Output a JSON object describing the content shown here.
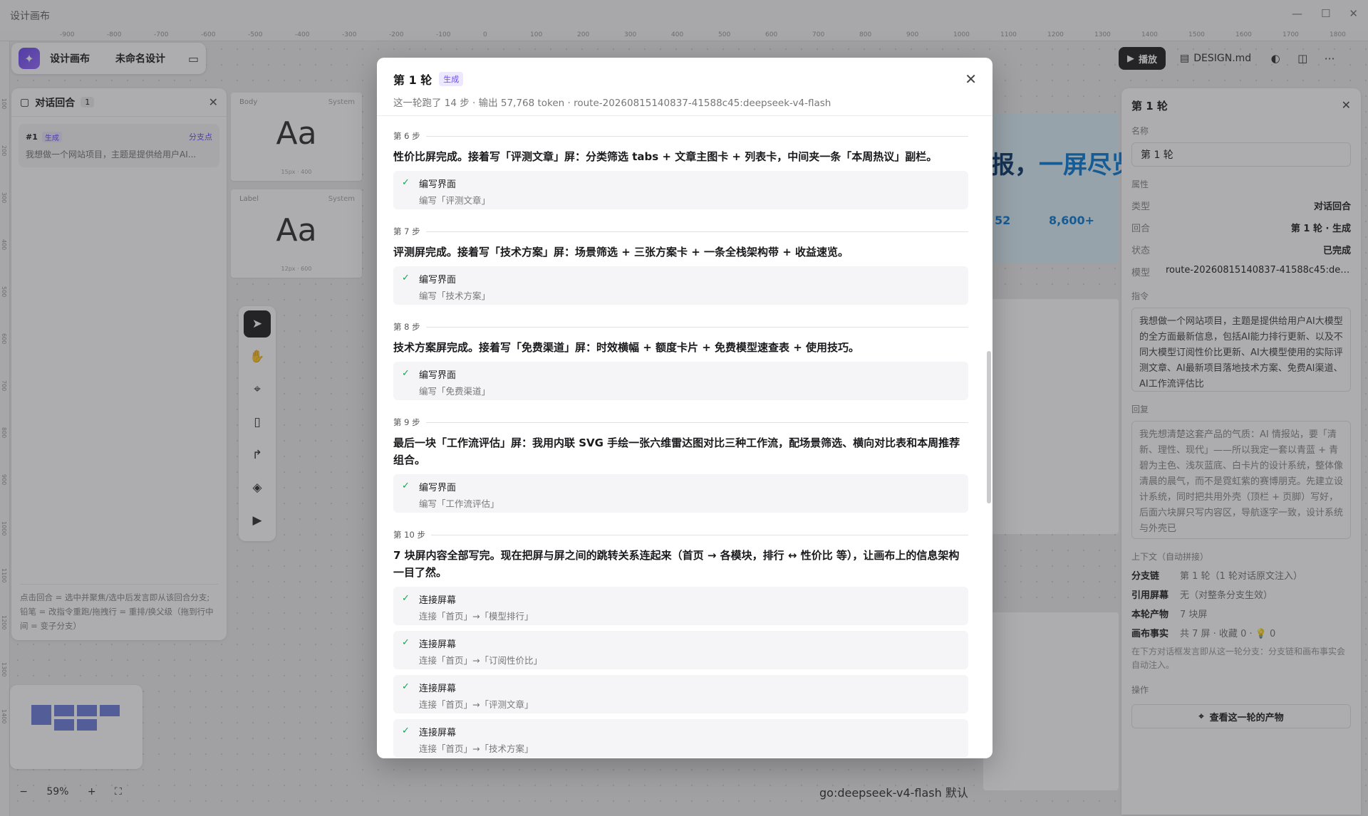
{
  "app": {
    "window_title": "设计画布",
    "name": "设计画布",
    "doc_name": "未命名设计",
    "window_controls": [
      "—",
      "☐",
      "✕"
    ]
  },
  "ruler": {
    "top_ticks": [
      "-900",
      "-800",
      "-700",
      "-600",
      "-500",
      "-400",
      "-300",
      "-200",
      "-100",
      "0",
      "100",
      "200",
      "300",
      "400",
      "500",
      "600",
      "700",
      "800",
      "900",
      "1000",
      "1100",
      "1200",
      "1300",
      "1400",
      "1500",
      "1600",
      "1700",
      "1800"
    ],
    "left_ticks": [
      "100",
      "200",
      "300",
      "400",
      "500",
      "600",
      "700",
      "800",
      "900",
      "1000",
      "1100",
      "1200",
      "1300",
      "1400"
    ]
  },
  "left_panel": {
    "title": "对话回合",
    "count": "1",
    "round": {
      "number": "#1",
      "tag": "生成",
      "branch": "分支点",
      "text": "我想做一个网站项目，主题是提供给用户AI..."
    },
    "hint": "点击回合 = 选中并聚焦/选中后发言即从该回合分支; 铅笔 = 改指令重跑/拖拽行 = 重排/换父级（拖到行中间 = 变子分支）"
  },
  "type_cards": [
    {
      "label": "Body",
      "sys": "System",
      "sample": "Aa",
      "meta": "15px · 400"
    },
    {
      "label": "Label",
      "sys": "System",
      "sample": "Aa",
      "meta": "12px · 600"
    }
  ],
  "zoom": {
    "value": "59%",
    "minus": "−",
    "plus": "+"
  },
  "right_header": {
    "play_label": "播放",
    "design_md": "DESIGN.md"
  },
  "right_panel": {
    "title": "第 1 轮",
    "name_label": "名称",
    "name_value": "第 1 轮",
    "props_label": "属性",
    "props": [
      {
        "k": "类型",
        "v": "对话回合"
      },
      {
        "k": "回合",
        "v": "第 1 轮 · 生成"
      },
      {
        "k": "状态",
        "v": "已完成"
      },
      {
        "k": "模型",
        "v": "route-20260815140837-41588c45:deepseek-v4-flash"
      }
    ],
    "instruction_label": "指令",
    "instruction": "我想做一个网站项目，主题是提供给用户AI大模型的全方面最新信息，包括AI能力排行更新、以及不同大模型订阅性价比更新、AI大模型使用的实际评测文章、AI最新项目落地技术方案、免费AI渠道、AI工作流评估比",
    "reply_label": "回复",
    "reply": "我先想清楚这套产品的气质：AI 情报站，要「清新、理性、现代」——所以我定一套以青蓝 + 青碧为主色、浅灰蓝底、白卡片的设计系统，整体像清晨的晨气，而不是霓虹紫的赛博朋克。先建立设计系统，同时把共用外壳（顶栏 + 页脚）写好，后面六块屏只写内容区，导航逐字一致，设计系统与外壳已",
    "context_label": "上下文（自动拼接）",
    "context": [
      {
        "k": "分支链",
        "v": "第 1 轮（1 轮对话原文注入）"
      },
      {
        "k": "引用屏幕",
        "v": "无（对整条分支生效）"
      },
      {
        "k": "本轮产物",
        "v": "7 块屏"
      },
      {
        "k": "画布事实",
        "v": "共 7 屏 · 收藏 0 · 💡 0"
      }
    ],
    "context_note": "在下方对话框发言即从这一轮分支：分支链和画布事实会自动注入。",
    "ops_label": "操作",
    "ops_button": "查看这一轮的产物"
  },
  "bg_preview": {
    "headline_a": "报，",
    "headline_b": "一屏尽览",
    "stat1": "52",
    "stat2": "8,600+"
  },
  "bottom_chip": "go:deepseek-v4-flash   默认",
  "modal": {
    "title": "第 1 轮",
    "badge": "生成",
    "subtitle": "这一轮跑了 14 步 · 输出 57,768 token · route-20260815140837-41588c45:deepseek-v4-flash",
    "steps": [
      {
        "label": "第 6 步",
        "text": "性价比屏完成。接着写「评测文章」屏：分类筛选 tabs + 文章主图卡 + 列表卡，中间夹一条「本周热议」副栏。",
        "actions": [
          {
            "title": "编写界面",
            "detail": "编写「评测文章」"
          }
        ]
      },
      {
        "label": "第 7 步",
        "text": "评测屏完成。接着写「技术方案」屏：场景筛选 + 三张方案卡 + 一条全栈架构带 + 收益速览。",
        "actions": [
          {
            "title": "编写界面",
            "detail": "编写「技术方案」"
          }
        ]
      },
      {
        "label": "第 8 步",
        "text": "技术方案屏完成。接着写「免费渠道」屏：时效横幅 + 额度卡片 + 免费模型速查表 + 使用技巧。",
        "actions": [
          {
            "title": "编写界面",
            "detail": "编写「免费渠道」"
          }
        ]
      },
      {
        "label": "第 9 步",
        "text": "最后一块「工作流评估」屏：我用内联 SVG 手绘一张六维雷达图对比三种工作流，配场景筛选、横向对比表和本周推荐组合。",
        "actions": [
          {
            "title": "编写界面",
            "detail": "编写「工作流评估」"
          }
        ]
      },
      {
        "label": "第 10 步",
        "text": "7 块屏内容全部写完。现在把屏与屏之间的跳转关系连起来（首页 → 各模块，排行 ↔ 性价比 等），让画布上的信息架构一目了然。",
        "actions": [
          {
            "title": "连接屏幕",
            "detail": "连接「首页」→「模型排行」"
          },
          {
            "title": "连接屏幕",
            "detail": "连接「首页」→「订阅性价比」"
          },
          {
            "title": "连接屏幕",
            "detail": "连接「首页」→「评测文章」"
          },
          {
            "title": "连接屏幕",
            "detail": "连接「首页」→「技术方案」"
          }
        ]
      }
    ]
  }
}
